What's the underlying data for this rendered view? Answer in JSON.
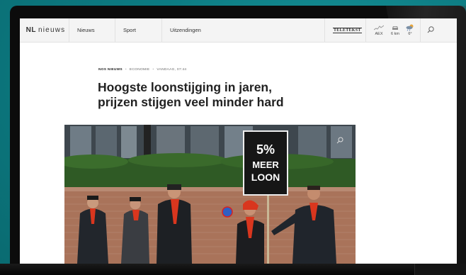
{
  "site": {
    "logo_prefix": "NL",
    "logo_word": "nieuws"
  },
  "nav": {
    "items": [
      "Nieuws",
      "Sport",
      "Uitzendingen"
    ]
  },
  "teletext": "TELETEKST",
  "stats": {
    "aex": "AEX",
    "traffic": "6 km",
    "temperature": "6°"
  },
  "article": {
    "source": "NOS NIEUWS",
    "category": "ECONOMIE",
    "timestamp": "VANDAAG, 07:44",
    "headline_line1": "Hoogste loonstijging in jaren,",
    "headline_line2": "prijzen stijgen veel minder hard"
  },
  "photo": {
    "sign_line1": "5%",
    "sign_line2": "MEER",
    "sign_line3": "LOON"
  },
  "colors": {
    "background": "#0f7f86",
    "scarf_red": "#d9361e",
    "brand": "#222222"
  },
  "icons": [
    "chart-icon",
    "car-icon",
    "weather-icon",
    "search-icon"
  ]
}
